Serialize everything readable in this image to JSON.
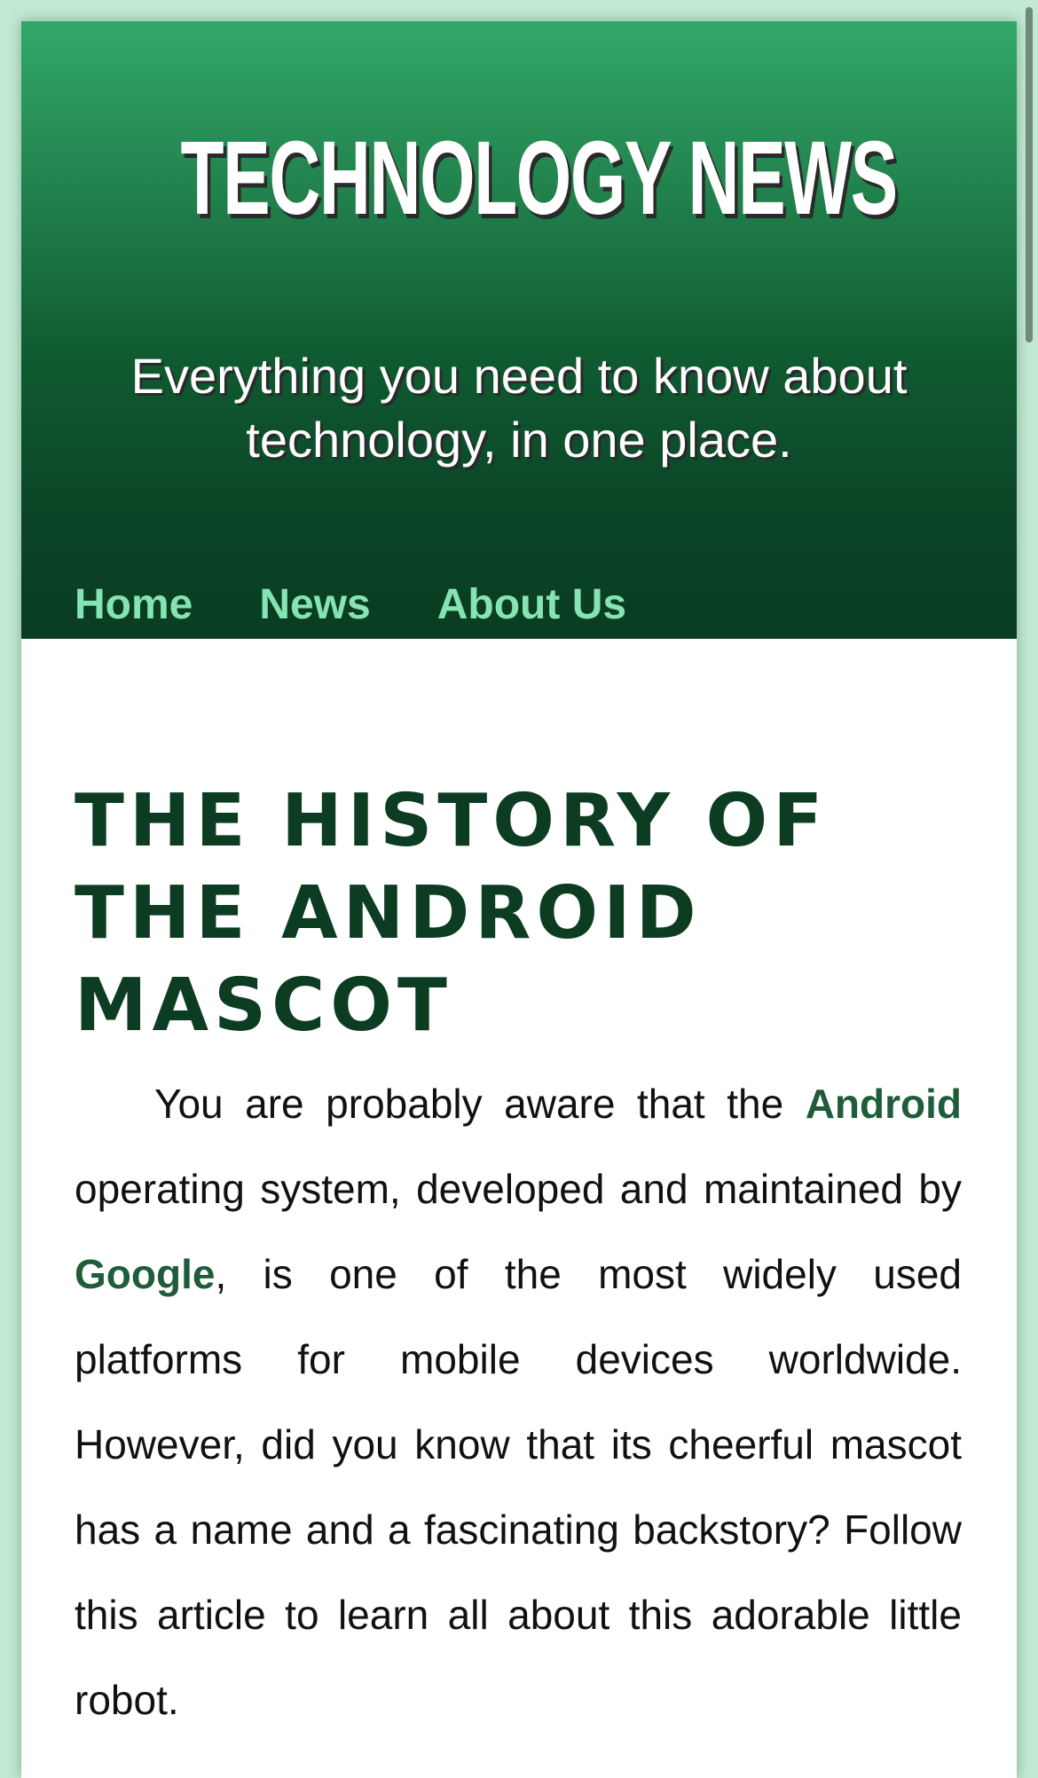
{
  "header": {
    "site_title": "TECHNOLOGY NEWS",
    "tagline": "Everything you need to know about technology, in one place."
  },
  "nav": {
    "items": [
      {
        "label": "Home"
      },
      {
        "label": "News"
      },
      {
        "label": "About Us"
      }
    ]
  },
  "article": {
    "title": "THE HISTORY OF THE ANDROID MASCOT",
    "body": {
      "part1": "You are probably aware that the ",
      "link1": "Android",
      "part2": " operating system, developed and maintained by ",
      "link2": "Google",
      "part3": ", is one of the most widely used platforms for mobile devices worldwide. However, did you know that its cheerful mascot has a name and a fascinating backstory? Follow this article to learn all about this adorable little robot."
    }
  },
  "colors": {
    "page_background": "#c2e9d4",
    "header_gradient_top": "#31a868",
    "header_gradient_bottom": "#0a3c22",
    "nav_link": "#86e3b2",
    "title_text": "#0c3d22",
    "inline_link": "#1e5c3a"
  }
}
